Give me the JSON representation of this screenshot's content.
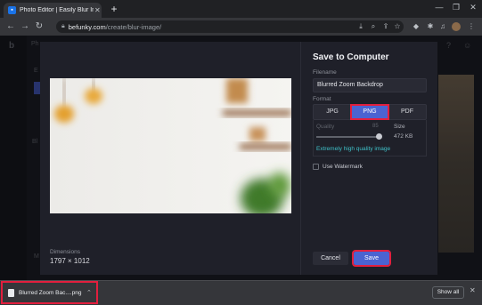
{
  "browser": {
    "tab_title": "Photo Editor | Easily Blur Image...",
    "tab_close": "✕",
    "new_tab": "+",
    "url_host": "befunky.com",
    "url_path": "/create/blur-image/"
  },
  "app": {
    "logo": "b",
    "sidebar_items": [
      "Ph",
      "E",
      "Bl",
      "M"
    ]
  },
  "dialog": {
    "title": "Save to Computer",
    "filename_label": "Filename",
    "filename_value": "Blurred Zoom Backdrop",
    "format_label": "Format",
    "formats": [
      "JPG",
      "PNG",
      "PDF"
    ],
    "selected_format": "PNG",
    "quality_label": "Quality",
    "quality_value": "85",
    "size_label": "Size",
    "size_value": "472 KB",
    "quality_note": "Extremely high quality image",
    "watermark_label": "Use Watermark",
    "watermark_checked": false,
    "dimensions_label": "Dimensions",
    "dimensions_value": "1797 × 1012",
    "cancel_label": "Cancel",
    "save_label": "Save"
  },
  "downloads": {
    "file_name": "Blurred Zoom Bac....png",
    "show_all_label": "Show all",
    "close": "✕"
  },
  "colors": {
    "accent": "#4b63d1",
    "highlight": "#e21f3e",
    "note": "#3fc1c9"
  }
}
